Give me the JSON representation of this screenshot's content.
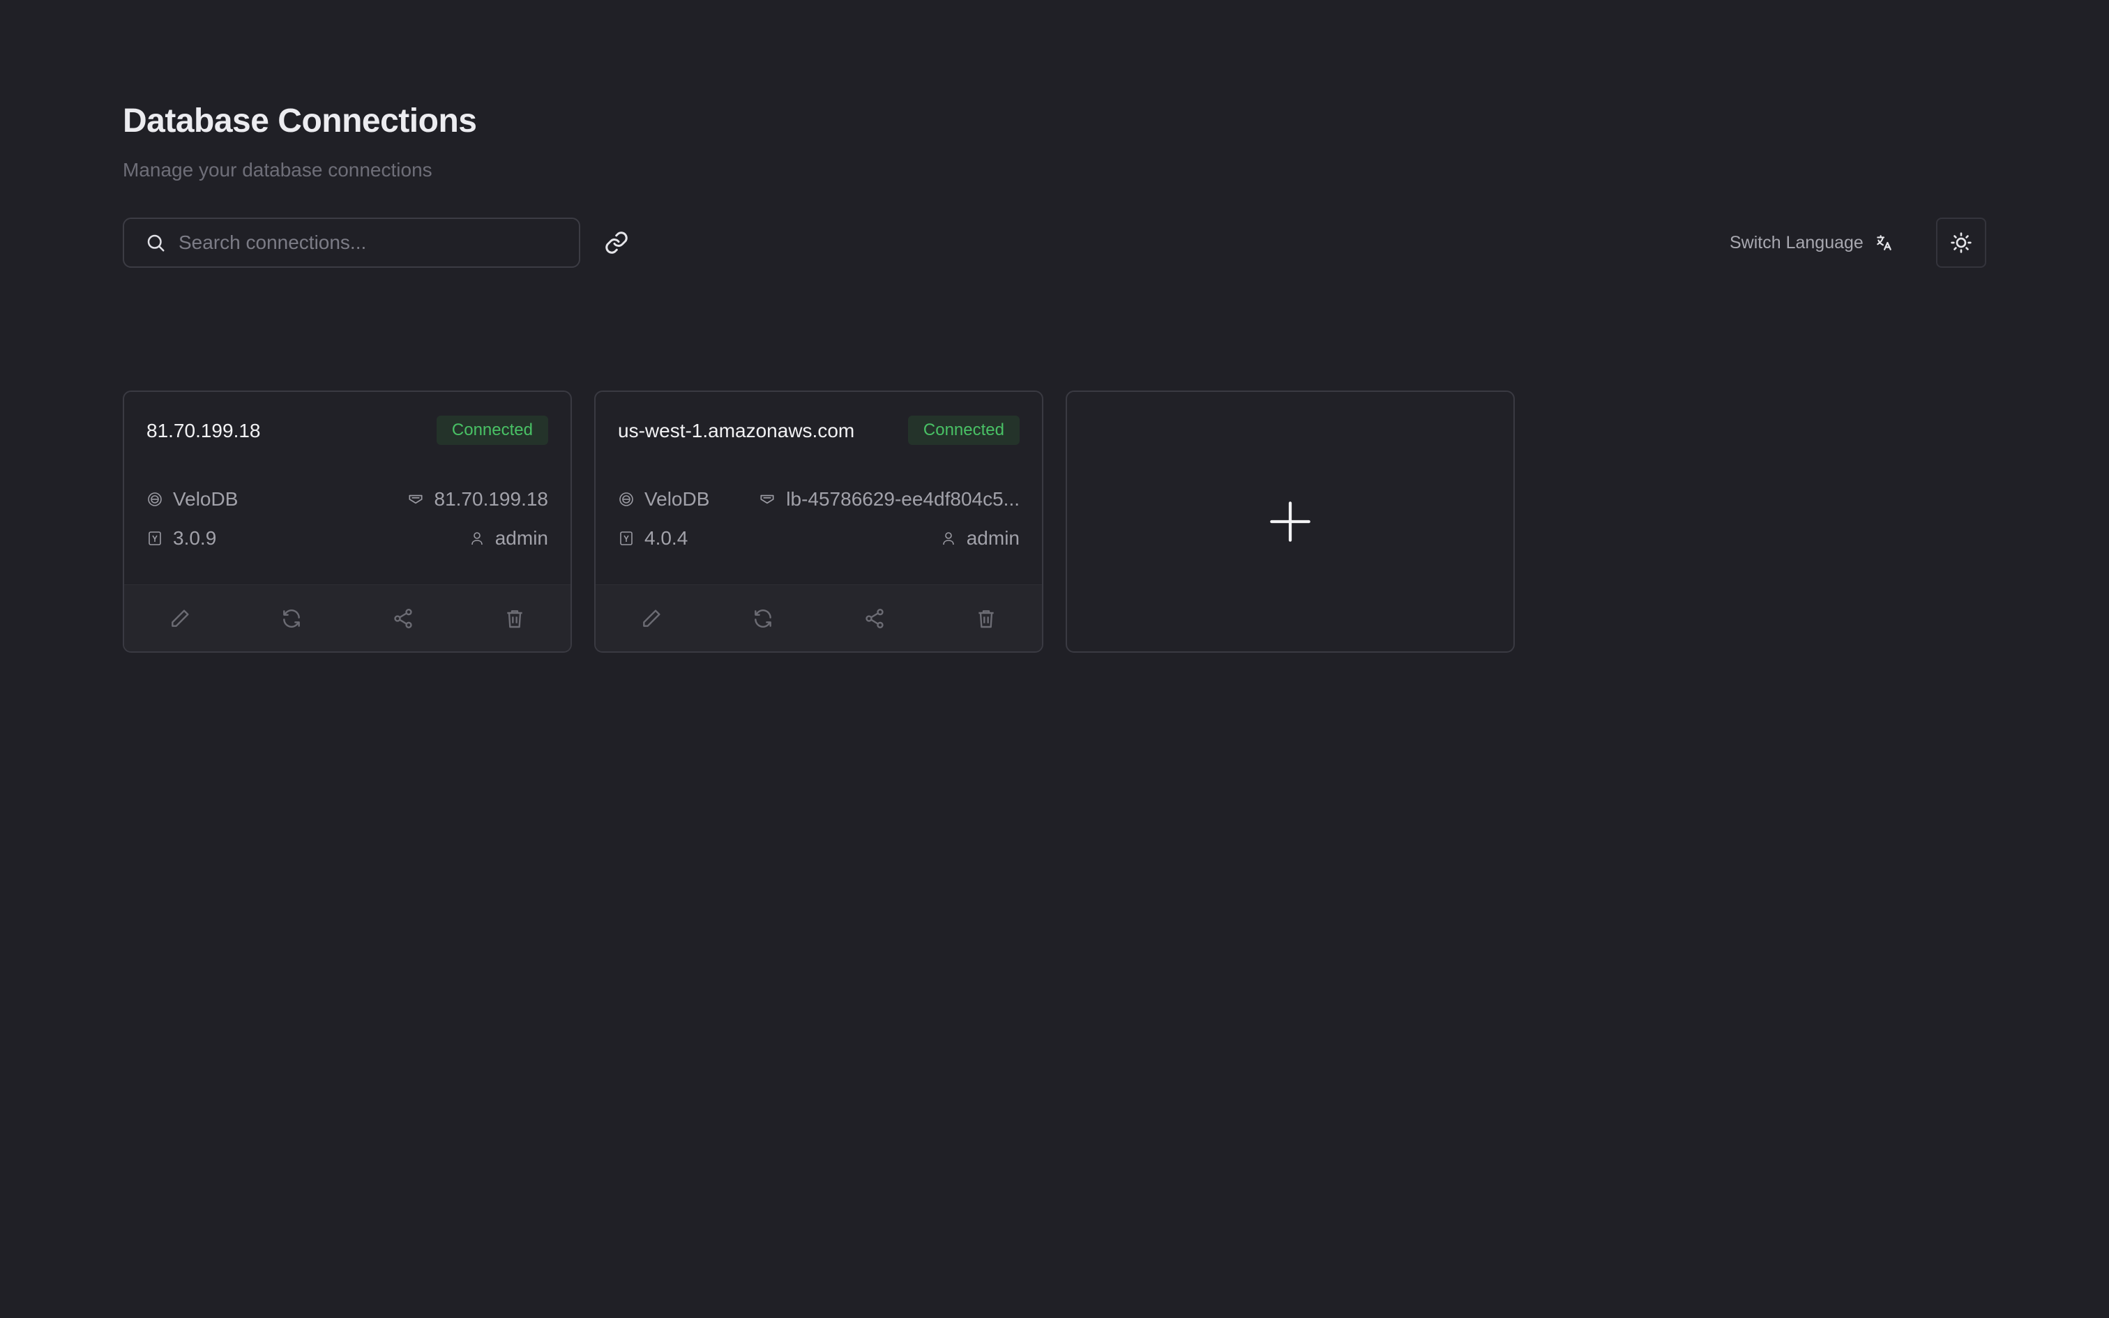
{
  "page": {
    "title": "Database Connections",
    "subtitle": "Manage your database connections"
  },
  "toolbar": {
    "search_placeholder": "Search connections...",
    "search_value": "",
    "link_icon": "link-icon",
    "switch_language_label": "Switch Language",
    "language_icon": "translate-icon",
    "theme_icon": "sun-icon"
  },
  "connections": [
    {
      "host": "81.70.199.18",
      "status": "Connected",
      "db_type": "VeloDB",
      "address": "81.70.199.18",
      "version": "3.0.9",
      "user": "admin"
    },
    {
      "host": "us-west-1.amazonaws.com",
      "status": "Connected",
      "db_type": "VeloDB",
      "address": "lb-45786629-ee4df804c5...",
      "version": "4.0.4",
      "user": "admin"
    }
  ],
  "card_actions": [
    "edit-icon",
    "refresh-icon",
    "share-icon",
    "trash-icon"
  ],
  "add_card_icon": "plus-icon",
  "colors": {
    "background": "#202026",
    "status_connected": "#49c165",
    "status_badge_bg": "#24332a",
    "border": "#3a3a42"
  }
}
